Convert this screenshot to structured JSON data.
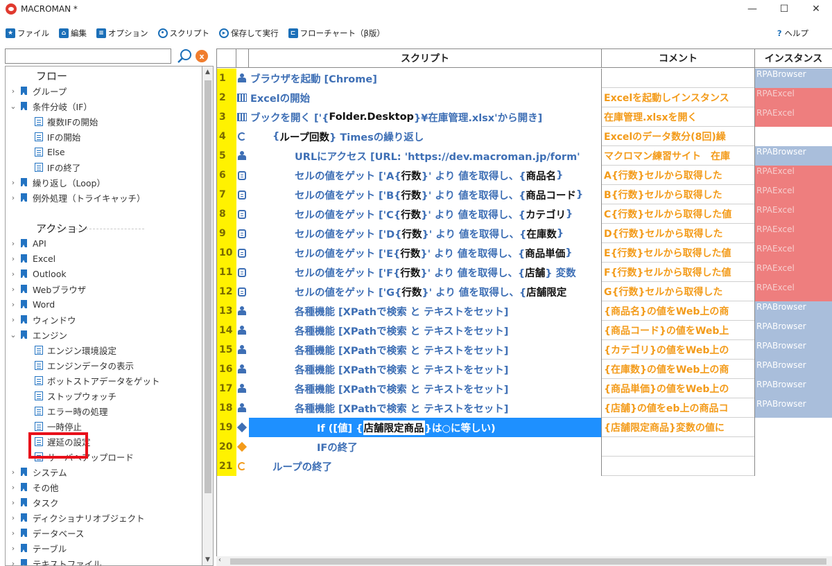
{
  "window": {
    "title": "MACROMAN *",
    "minimize": "—",
    "maximize": "☐",
    "close": "✕"
  },
  "menu": {
    "file": "ファイル",
    "edit": "編集",
    "options": "オプション",
    "script": "スクリプト",
    "save_run": "保存して実行",
    "flowchart": "フローチャート（β版）",
    "help": "ヘルプ"
  },
  "search": {
    "placeholder": "",
    "value": ""
  },
  "tree": {
    "flow_section": "フロー",
    "flow_items": [
      "グループ",
      "条件分岐（IF）"
    ],
    "if_children": [
      "複数IFの開始",
      "IFの開始",
      "Else",
      "IFの終了"
    ],
    "flow_items2": [
      "繰り返し（Loop）",
      "例外処理（トライキャッチ）"
    ],
    "action_section": "アクション",
    "action_items": [
      "API",
      "Excel",
      "Outlook",
      "Webブラウザ",
      "Word",
      "ウィンドウ",
      "エンジン"
    ],
    "engine_children": [
      "エンジン環境設定",
      "エンジンデータの表示",
      "ボットストアデータをゲット",
      "ストップウォッチ",
      "エラー時の処理",
      "一時停止",
      "遅延の設定",
      "サーバへアップロード"
    ],
    "action_items2": [
      "システム",
      "その他",
      "タスク",
      "ディクショナリオブジェクト",
      "データベース",
      "テーブル",
      "テキストファイル"
    ]
  },
  "grid": {
    "headers": {
      "script": "スクリプト",
      "comment": "コメント",
      "instance": "インスタンス"
    },
    "rows": [
      {
        "n": "1",
        "icon": "browser",
        "indent": 0,
        "pre": "ブラウザを起動 [Chrome]",
        "comment": "",
        "inst": "RPABrowser",
        "inst_color": "blue"
      },
      {
        "n": "2",
        "icon": "excel",
        "indent": 0,
        "pre": "Excelの開始",
        "comment": "Excelを起動しインスタンス",
        "inst": "RPAExcel",
        "inst_color": "red"
      },
      {
        "n": "3",
        "icon": "excel",
        "indent": 0,
        "pre": "ブックを開く ['{",
        "kw": "Folder.Desktop",
        "post": "}¥在庫管理.xlsx'から開き]",
        "comment": "在庫管理.xlsxを開く",
        "inst": "RPAExcel",
        "inst_color": "red"
      },
      {
        "n": "4",
        "icon": "loop",
        "indent": 1,
        "pre": "{",
        "kw": "ループ回数",
        "post": "} Timesの繰り返し",
        "comment": "Excelのデータ数分(8回)繰",
        "inst": "",
        "inst_color": ""
      },
      {
        "n": "5",
        "icon": "browser",
        "indent": 2,
        "pre": "URLにアクセス [URL: 'https://dev.macroman.jp/form'",
        "comment": "マクロマン練習サイト　在庫",
        "inst": "RPABrowser",
        "inst_color": "blue"
      },
      {
        "n": "6",
        "icon": "cell",
        "indent": 2,
        "pre": "セルの値をゲット ['A{",
        "kw": "行数",
        "post": "}' より 値を取得し、{",
        "kw2": "商品名",
        "post2": "}",
        "comment": "A{行数}セルから取得した",
        "inst": "RPAExcel",
        "inst_color": "red"
      },
      {
        "n": "7",
        "icon": "cell",
        "indent": 2,
        "pre": "セルの値をゲット ['B{",
        "kw": "行数",
        "post": "}' より 値を取得し、{",
        "kw2": "商品コード",
        "post2": "}",
        "comment": "B{行数}セルから取得した",
        "inst": "RPAExcel",
        "inst_color": "red"
      },
      {
        "n": "8",
        "icon": "cell",
        "indent": 2,
        "pre": "セルの値をゲット ['C{",
        "kw": "行数",
        "post": "}' より 値を取得し、{",
        "kw2": "カテゴリ",
        "post2": "}",
        "comment": "C{行数}セルから取得した値",
        "inst": "RPAExcel",
        "inst_color": "red"
      },
      {
        "n": "9",
        "icon": "cell",
        "indent": 2,
        "pre": "セルの値をゲット ['D{",
        "kw": "行数",
        "post": "}' より 値を取得し、{",
        "kw2": "在庫数",
        "post2": "}",
        "comment": "D{行数}セルから取得した",
        "inst": "RPAExcel",
        "inst_color": "red"
      },
      {
        "n": "10",
        "icon": "cell",
        "indent": 2,
        "pre": "セルの値をゲット ['E{",
        "kw": "行数",
        "post": "}' より 値を取得し、{",
        "kw2": "商品単価",
        "post2": "}",
        "comment": "E{行数}セルから取得した値",
        "inst": "RPAExcel",
        "inst_color": "red"
      },
      {
        "n": "11",
        "icon": "cell",
        "indent": 2,
        "pre": "セルの値をゲット ['F{",
        "kw": "行数",
        "post": "}' より 値を取得し、{",
        "kw2": "店舗",
        "post2": "} 変数",
        "comment": "F{行数}セルから取得した値",
        "inst": "RPAExcel",
        "inst_color": "red"
      },
      {
        "n": "12",
        "icon": "cell",
        "indent": 2,
        "pre": "セルの値をゲット ['G{",
        "kw": "行数",
        "post": "}' より 値を取得し、{",
        "kw2": "店舗限定",
        "post2": "",
        "comment": "G{行数}セルから取得した",
        "inst": "RPAExcel",
        "inst_color": "red"
      },
      {
        "n": "13",
        "icon": "browser",
        "indent": 2,
        "pre": "各種機能 [XPathで検索 と テキストをセット]",
        "comment": "{商品名}の値をWeb上の商",
        "inst": "RPABrowser",
        "inst_color": "blue"
      },
      {
        "n": "14",
        "icon": "browser",
        "indent": 2,
        "pre": "各種機能 [XPathで検索 と テキストをセット]",
        "comment": "{商品コード}の値をWeb上",
        "inst": "RPABrowser",
        "inst_color": "blue"
      },
      {
        "n": "15",
        "icon": "browser",
        "indent": 2,
        "pre": "各種機能 [XPathで検索 と テキストをセット]",
        "comment": "{カテゴリ}の値をWeb上の",
        "inst": "RPABrowser",
        "inst_color": "blue"
      },
      {
        "n": "16",
        "icon": "browser",
        "indent": 2,
        "pre": "各種機能 [XPathで検索 と テキストをセット]",
        "comment": "{在庫数}の値をWeb上の商",
        "inst": "RPABrowser",
        "inst_color": "blue"
      },
      {
        "n": "17",
        "icon": "browser",
        "indent": 2,
        "pre": "各種機能 [XPathで検索 と テキストをセット]",
        "comment": "{商品単価}の値をWeb上の",
        "inst": "RPABrowser",
        "inst_color": "blue"
      },
      {
        "n": "18",
        "icon": "browser",
        "indent": 2,
        "pre": "各種機能 [XPathで検索 と テキストをセット]",
        "comment": "{店舗}の値をeb上の商品コ",
        "inst": "RPABrowser",
        "inst_color": "blue"
      },
      {
        "n": "19",
        "icon": "diamond",
        "indent": 3,
        "pre": "If ([値] {",
        "kw": "店舗限定商品",
        "post": "}は○に等しい)",
        "comment": "{店舗限定商品}変数の値に",
        "inst": "",
        "inst_color": "",
        "selected": true
      },
      {
        "n": "20",
        "icon": "diamond-orange",
        "indent": 3,
        "pre": "IFの終了",
        "comment": "",
        "inst": "",
        "inst_color": ""
      },
      {
        "n": "21",
        "icon": "loop-orange",
        "indent": 1,
        "pre": "ループの終了",
        "comment": "",
        "inst": "",
        "inst_color": ""
      }
    ]
  },
  "colors": {
    "accent": "#1b6fb8",
    "line_number_bg": "#fff200",
    "comment_text": "#f39b1a",
    "script_text": "#3e6fb5",
    "selected": "#1e90ff",
    "inst_blue": "#a9bedb",
    "inst_red": "#ee7e7e",
    "highlight": "#e8101a"
  }
}
